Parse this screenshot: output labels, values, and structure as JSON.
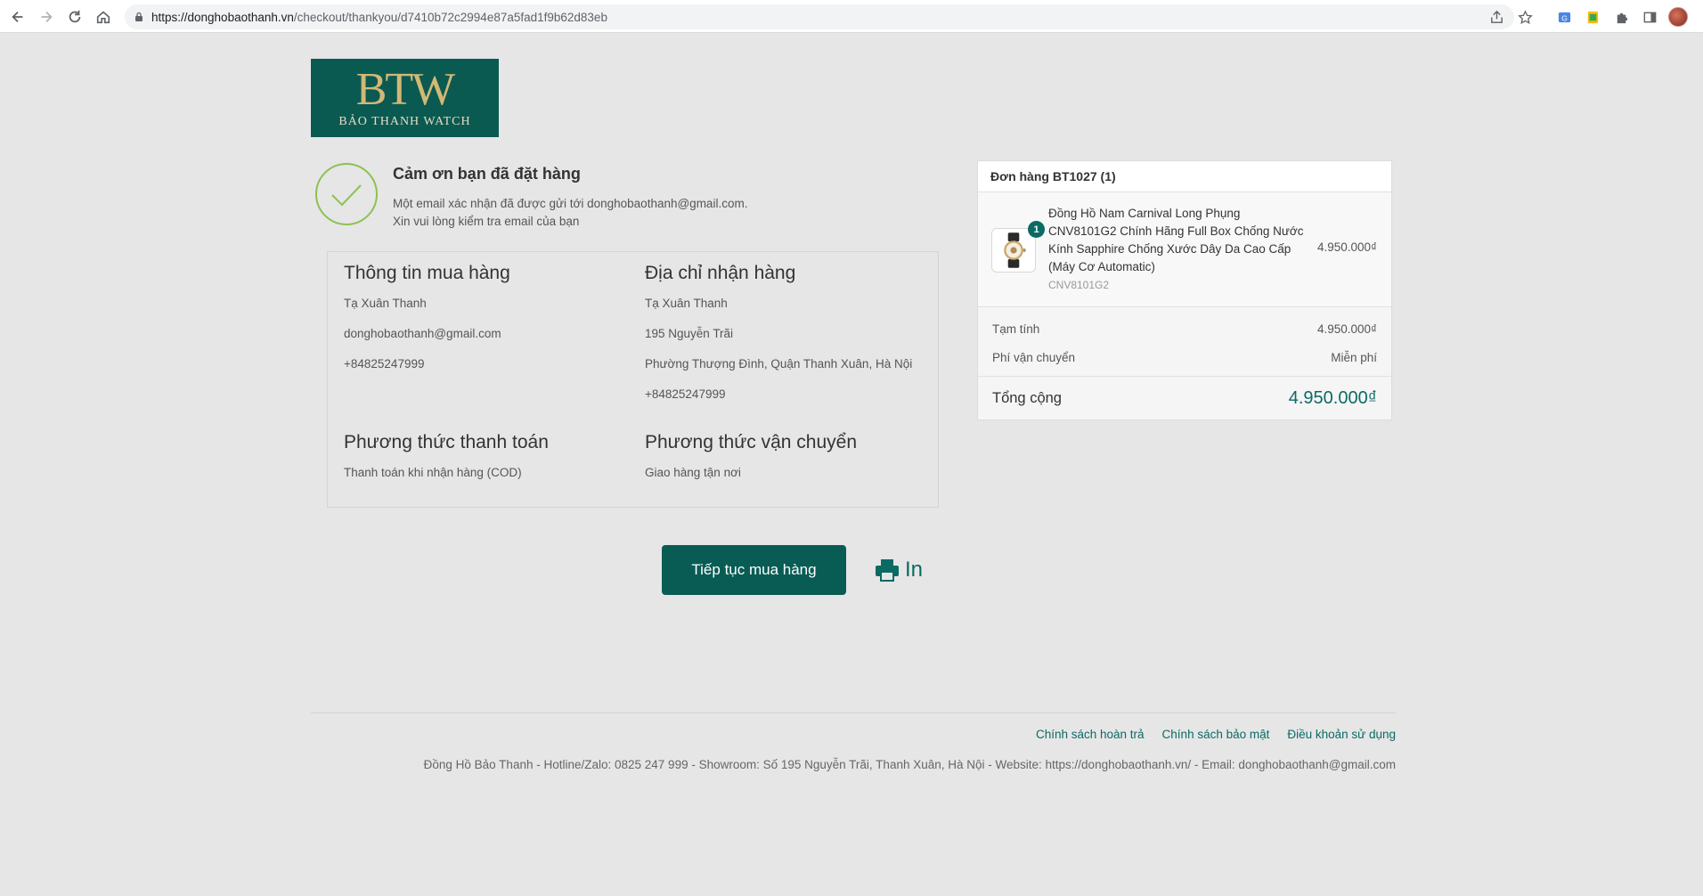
{
  "browser": {
    "url_host": "https://donghobaothanh.vn",
    "url_path": "/checkout/thankyou/d7410b72c2994e87a5fad1f9b62d83eb"
  },
  "logo": {
    "mark": "BTW",
    "text": "BẢO THANH WATCH"
  },
  "thanks": {
    "title": "Cảm ơn bạn đã đặt hàng",
    "line1": "Một email xác nhận đã được gửi tới donghobaothanh@gmail.com.",
    "line2": "Xin vui lòng kiểm tra email của bạn"
  },
  "purchase_info": {
    "heading": "Thông tin mua hàng",
    "name": "Tạ Xuân Thanh",
    "email": "donghobaothanh@gmail.com",
    "phone": "+84825247999"
  },
  "shipping_address": {
    "heading": "Địa chỉ nhận hàng",
    "name": "Tạ Xuân Thanh",
    "street": "195 Nguyễn Trãi",
    "ward": "Phường Thượng Đình, Quận Thanh Xuân, Hà Nội",
    "phone": "+84825247999"
  },
  "payment": {
    "heading": "Phương thức thanh toán",
    "value": "Thanh toán khi nhận hàng (COD)"
  },
  "shipping_method": {
    "heading": "Phương thức vận chuyển",
    "value": "Giao hàng tận nơi"
  },
  "actions": {
    "continue_label": "Tiếp tục mua hàng",
    "print_label": "In"
  },
  "order": {
    "header": "Đơn hàng BT1027 (1)",
    "item": {
      "quantity": "1",
      "name": "Đồng Hồ Nam Carnival Long Phụng CNV8101G2 Chính Hãng Full Box Chống Nước Kính Sapphire Chống Xước Dây Da Cao Cấp (Máy Cơ Automatic)",
      "sku": "CNV8101G2",
      "price": "4.950.000₫"
    },
    "subtotal_label": "Tạm tính",
    "subtotal_value": "4.950.000₫",
    "shipping_label": "Phí vận chuyển",
    "shipping_value": "Miễn phí",
    "total_label": "Tổng cộng",
    "total_value": "4.950.000₫"
  },
  "footer": {
    "link_refund": "Chính sách hoàn trả",
    "link_privacy": "Chính sách bảo mật",
    "link_terms": "Điều khoản sử dụng",
    "info": "Đồng Hồ Bảo Thanh - Hotline/Zalo: 0825 247 999 - Showroom: Số 195 Nguyễn Trãi, Thanh Xuân, Hà Nội - Website: https://donghobaothanh.vn/ - Email: donghobaothanh@gmail.com"
  },
  "colors": {
    "brand": "#0b5a52",
    "accent": "#0b6a64",
    "background": "#e6e6e6"
  }
}
